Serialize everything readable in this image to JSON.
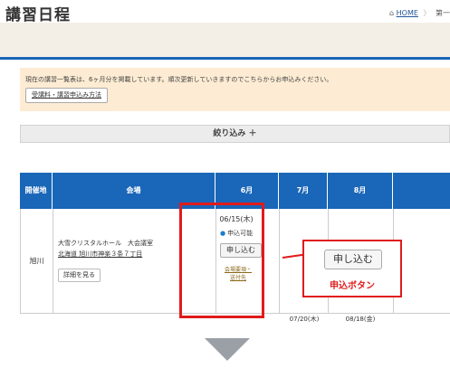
{
  "page": {
    "title": "講習日程",
    "breadcrumb": {
      "home": "HOME",
      "sep": "〉",
      "current": "第一"
    }
  },
  "notice": {
    "text": "現在の講習一覧表は、6ヶ月分を掲載しています。順次更新していきますのでこちらからお申込みください。",
    "button": "受講料・講習申込み方法"
  },
  "filter": {
    "label": "絞り込み ＋"
  },
  "table": {
    "headers": [
      "開催地",
      "会場",
      "6月",
      "7月",
      "8月"
    ],
    "row": {
      "city": "旭川",
      "venue_name": "大雪クリスタルホール　大会議室",
      "venue_address": "北海道 旭川市神楽３条７丁目",
      "detail_button": "詳細を見る",
      "june": {
        "date": "06/15(木)",
        "status": "申込可能",
        "apply_button": "申し込む",
        "link": "会場要項・\n送付先"
      }
    },
    "next_row": {
      "july": "07/20(木)",
      "august": "08/18(金)"
    }
  },
  "callout": {
    "button": "申し込む",
    "label": "申込ボタン"
  },
  "colors": {
    "header_blue": "#1a66b8",
    "highlight_red": "#e01b1b",
    "notice_bg": "#fdecd3"
  }
}
